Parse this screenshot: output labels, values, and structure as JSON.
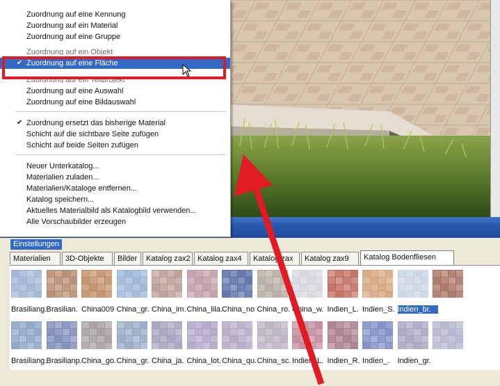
{
  "menu": {
    "items": [
      {
        "label": "Zuordnung auf eine Kennung",
        "checked": false
      },
      {
        "label": "Zuordnung auf ein Material",
        "checked": false
      },
      {
        "label": "Zuordnung auf eine Gruppe",
        "checked": false
      },
      {
        "label": "Zuordnung auf ein Objekt",
        "checked": false
      },
      {
        "label": "Zuordnung auf eine Fläche",
        "checked": true
      },
      {
        "label": "Zuordnung auf ein Teilprojekt",
        "checked": false
      },
      {
        "label": "Zuordnung auf eine Auswahl",
        "checked": false
      },
      {
        "label": "Zuordnung auf eine Bildauswahl",
        "checked": false
      },
      {
        "label": "Zuordnung ersetzt das bisherige Material",
        "checked": true
      },
      {
        "label": "Schicht auf die sichtbare Seite zufügen",
        "checked": false
      },
      {
        "label": "Schicht auf beide Seiten zufügen",
        "checked": false
      },
      {
        "label": "Neuer Unterkatalog...",
        "checked": false
      },
      {
        "label": "Materialien zuladen...",
        "checked": false
      },
      {
        "label": "Materialien/Kataloge entfernen...",
        "checked": false
      },
      {
        "label": "Katalog speichern...",
        "checked": false
      },
      {
        "label": "Aktuelles Materialbild als Katalogbild verwenden...",
        "checked": false
      },
      {
        "label": "Alle Vorschaubilder erzeugen",
        "checked": false
      }
    ],
    "check_glyph": "✔"
  },
  "panel": {
    "settings_label": "Einstellungen",
    "tabs": [
      "Materialien",
      "3D-Objekte",
      "Bilder",
      "Katalog zax2",
      "Katalog zax4",
      "Katalog zax",
      "Katalog zax9",
      "Katalog Bodenfliesen"
    ],
    "active_tab": "Katalog Bodenfliesen",
    "row1": [
      "Brasiliang.",
      "Brasilian.",
      "China009",
      "China_gr.",
      "China_im.",
      "China_lila.",
      "China_no",
      "China_ro.",
      "China_w.",
      "Indien_L.",
      "Indien_S.",
      "Indien_br."
    ],
    "row2": [
      "Brasiliang.",
      "Brasilianp.",
      "China_go.",
      "China_gr.",
      "China_ja.",
      "China_lot.",
      "China_qu.",
      "China_sc.",
      "Indien_L.",
      "Indien_R.",
      "Indien_.",
      "Indien_gr."
    ],
    "selected_label": "Indien_br.",
    "row1_colors": [
      "#9fb4d4",
      "#b48a6c",
      "#c08c64",
      "#9ab4d6",
      "#b89c92",
      "#c09aa8",
      "#5a6ea8",
      "#b4aca4",
      "#d8d4dc",
      "#c06a5c",
      "#d4a47c",
      "#c8d4e4",
      "#a87060"
    ],
    "row2_colors": [
      "#8aa4c4",
      "#7c8ab8",
      "#a49c9c",
      "#94a8c4",
      "#a4a0bc",
      "#b0a4c4",
      "#b4a8c4",
      "#b8b0c0",
      "#c08898",
      "#a87c8c",
      "#7c8cc4",
      "#a8a4c0",
      "#b0b4cc"
    ]
  },
  "colors": {
    "highlight": "#3169c6",
    "annotation_red": "#e01b24"
  }
}
